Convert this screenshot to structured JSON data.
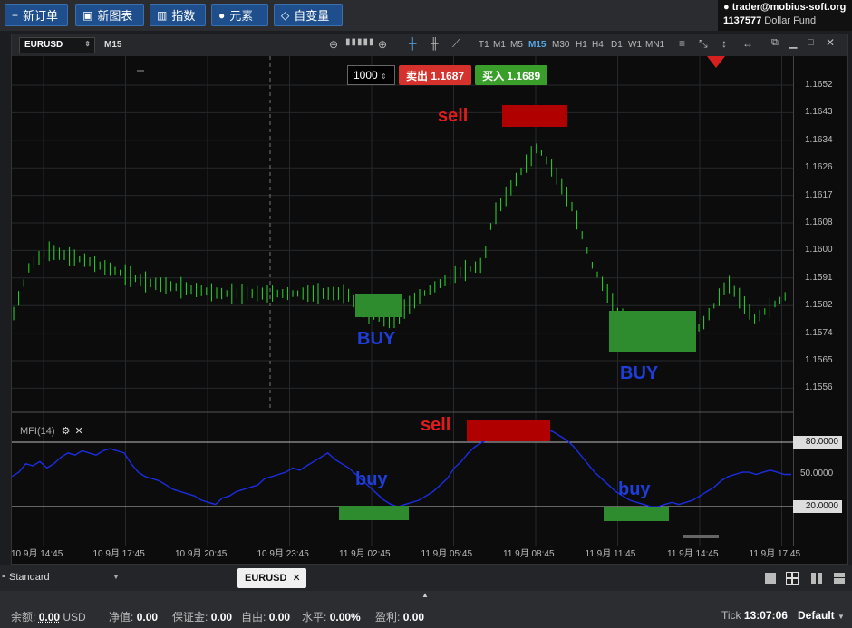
{
  "toolbar": {
    "new_order": "新订单",
    "new_chart": "新图表",
    "indicators": "指数",
    "elements": "元素",
    "variables": "自变量"
  },
  "account": {
    "user": "trader@mobius-soft.org",
    "number": "1137577",
    "name": "Dollar Fund"
  },
  "chart": {
    "symbol": "EURUSD",
    "timeframe": "M15",
    "timeframes": [
      "T1",
      "M1",
      "M5",
      "M15",
      "M30",
      "H1",
      "H4",
      "D1",
      "W1",
      "MN1"
    ],
    "active_timeframe": "M15",
    "lot": "1000",
    "sell_label": "卖出",
    "sell_price": "1.1687",
    "buy_label": "买入",
    "buy_price": "1.1689",
    "price_labels": [
      "1.1652",
      "1.1643",
      "1.1634",
      "1.1626",
      "1.1617",
      "1.1608",
      "1.1600",
      "1.1591",
      "1.1582",
      "1.1574",
      "1.1565",
      "1.1556"
    ],
    "time_labels": [
      "10 9月 14:45",
      "10 9月 17:45",
      "10 9月 20:45",
      "10 9月 23:45",
      "11 9月 02:45",
      "11 9月 05:45",
      "11 9月 08:45",
      "11 9月 11:45",
      "11 9月 14:45",
      "11 9月 17:45"
    ],
    "annotations": {
      "sell_top": "sell",
      "buy_left": "BUY",
      "buy_right": "BUY",
      "mfi_sell": "sell",
      "mfi_buy_left": "buy",
      "mfi_buy_right": "buy"
    },
    "colors": {
      "sell_zone": "#c00000",
      "buy_zone": "#2e8b2e",
      "candle": "#2fd62f",
      "mfi_line": "#1a2de0"
    }
  },
  "indicator": {
    "name": "MFI(14)",
    "level_high": "80.0000",
    "level_mid": "50.0000",
    "level_low": "20.0000"
  },
  "chart_data": {
    "type": "line",
    "series": [
      {
        "values": [
          48,
          52,
          60,
          58,
          62,
          56,
          60,
          66,
          70,
          68,
          72,
          70,
          68,
          72,
          74,
          72,
          70,
          60,
          52,
          48,
          46,
          44,
          40,
          36,
          34,
          32,
          30,
          26,
          24,
          22,
          28,
          30,
          34,
          36,
          38,
          40,
          46,
          48,
          50,
          52,
          56,
          54,
          58,
          62,
          66,
          70,
          64,
          60,
          56,
          50,
          44,
          38,
          32,
          26,
          22,
          20,
          22,
          24,
          26,
          30,
          34,
          40,
          46,
          56,
          62,
          70,
          76,
          80,
          82,
          84,
          86,
          88,
          88,
          90,
          92,
          92,
          92,
          90,
          86,
          82,
          76,
          68,
          60,
          52,
          46,
          40,
          34,
          30,
          26,
          24,
          22,
          20,
          20,
          22,
          24,
          22,
          24,
          26,
          30,
          34,
          38,
          44,
          48,
          50,
          52,
          52,
          50,
          52,
          54,
          52,
          50,
          50
        ]
      }
    ]
  },
  "workspace": {
    "name": "Standard",
    "tab": "EURUSD"
  },
  "status": {
    "balance_label": "余额:",
    "balance": "0.00",
    "currency": "USD",
    "equity_label": "净值:",
    "equity": "0.00",
    "margin_label": "保证金:",
    "margin": "0.00",
    "free_label": "自由:",
    "free": "0.00",
    "level_label": "水平:",
    "level": "0.00%",
    "profit_label": "盈利:",
    "profit": "0.00",
    "tick_label": "Tick",
    "time": "13:07:06",
    "profile": "Default"
  }
}
